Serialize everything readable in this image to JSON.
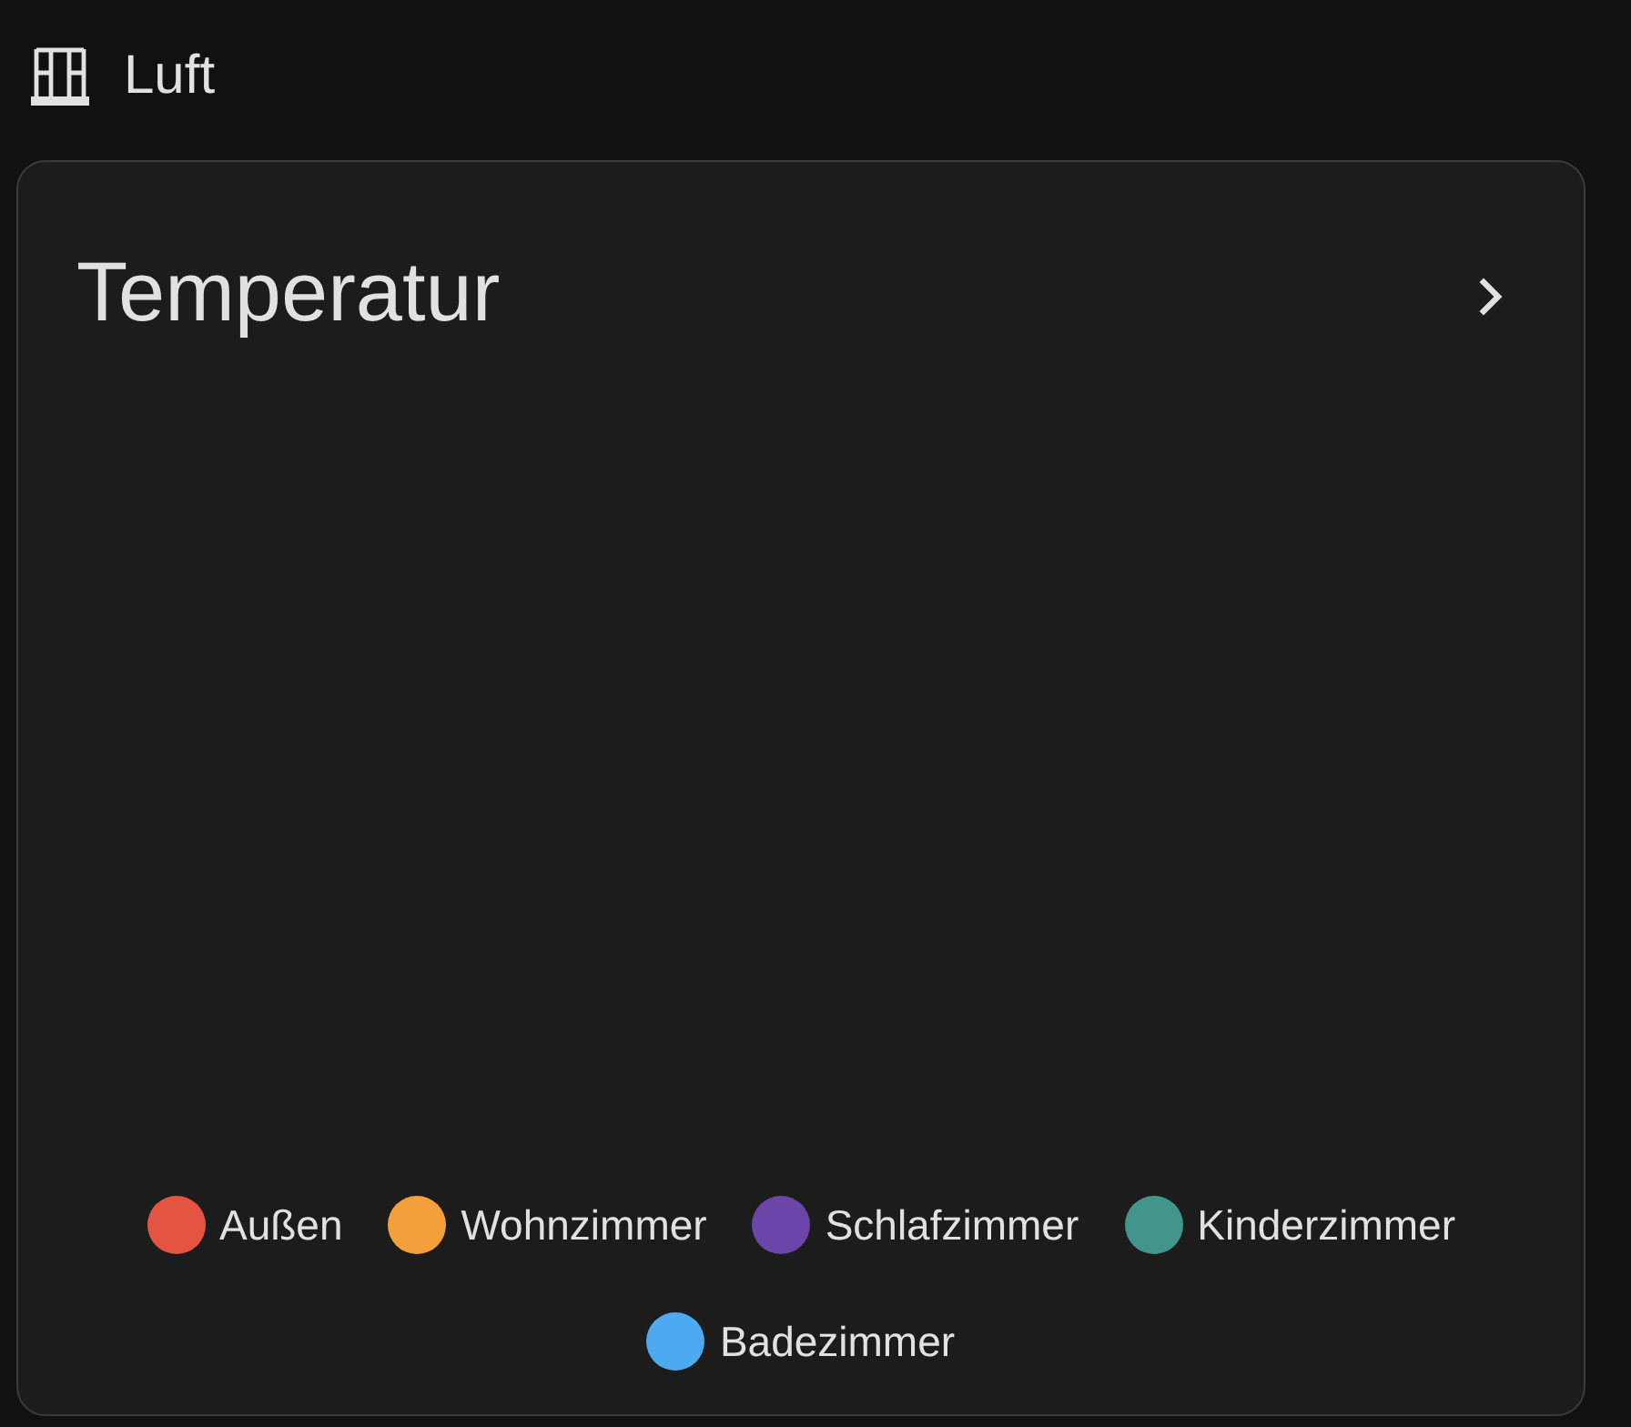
{
  "header": {
    "title": "Luft"
  },
  "card": {
    "title": "Temperatur",
    "legend": [
      {
        "label": "Außen",
        "color": "#e55443"
      },
      {
        "label": "Wohnzimmer",
        "color": "#f4a03a"
      },
      {
        "label": "Schlafzimmer",
        "color": "#6b45a8"
      },
      {
        "label": "Kinderzimmer",
        "color": "#41958a"
      },
      {
        "label": "Badezimmer",
        "color": "#4eaaf0"
      }
    ]
  }
}
